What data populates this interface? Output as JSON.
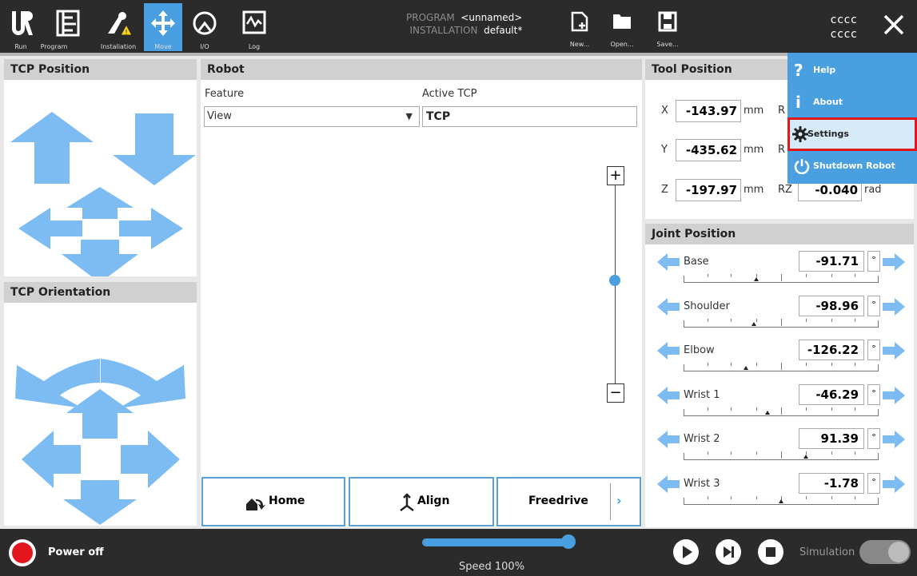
{
  "toolbar": {
    "run": "Run",
    "program": "Program",
    "installation": "Installation",
    "move": "Move",
    "io": "I/O",
    "log": "Log",
    "program_key": "PROGRAM",
    "program_val": "<unnamed>",
    "installation_key": "INSTALLATION",
    "installation_val": "default*",
    "new": "New...",
    "open": "Open...",
    "save": "Save...",
    "user1": "cccc",
    "user2": "cccc"
  },
  "tcp_position": {
    "title": "TCP Position"
  },
  "tcp_orientation": {
    "title": "TCP Orientation"
  },
  "robot": {
    "title": "Robot",
    "feature_label": "Feature",
    "feature_value": "View",
    "active_tcp_label": "Active TCP",
    "active_tcp_value": "TCP",
    "zoom_in": "+",
    "zoom_out": "−",
    "home": "Home",
    "align": "Align",
    "freedrive": "Freedrive"
  },
  "tool_position": {
    "title": "Tool Position",
    "x_label": "X",
    "x_value": "-143.97",
    "x_unit": "mm",
    "y_label": "Y",
    "y_value": "-435.62",
    "y_unit": "mm",
    "z_label": "Z",
    "z_value": "-197.97",
    "z_unit": "mm",
    "rx_label": "R",
    "ry_label": "R",
    "rz_label": "RZ",
    "rz_value": "-0.040",
    "rz_unit": "rad"
  },
  "joint_position": {
    "title": "Joint Position",
    "deg": "°",
    "joints": [
      {
        "name": "Base",
        "value": "-91.71",
        "level": 0.37
      },
      {
        "name": "Shoulder",
        "value": "-98.96",
        "level": 0.36
      },
      {
        "name": "Elbow",
        "value": "-126.22",
        "level": 0.32
      },
      {
        "name": "Wrist 1",
        "value": "-46.29",
        "level": 0.43
      },
      {
        "name": "Wrist 2",
        "value": "91.39",
        "level": 0.63
      },
      {
        "name": "Wrist 3",
        "value": "-1.78",
        "level": 0.5
      }
    ]
  },
  "menu": {
    "help": "Help",
    "about": "About",
    "settings": "Settings",
    "shutdown": "Shutdown Robot"
  },
  "bottom": {
    "power": "Power off",
    "speed": "Speed 100%",
    "speed_level": 1.0,
    "simulation": "Simulation"
  },
  "colors": {
    "accent": "#4a9fe0",
    "arrow": "#7cbcf2",
    "highlight": "#e3161e"
  }
}
